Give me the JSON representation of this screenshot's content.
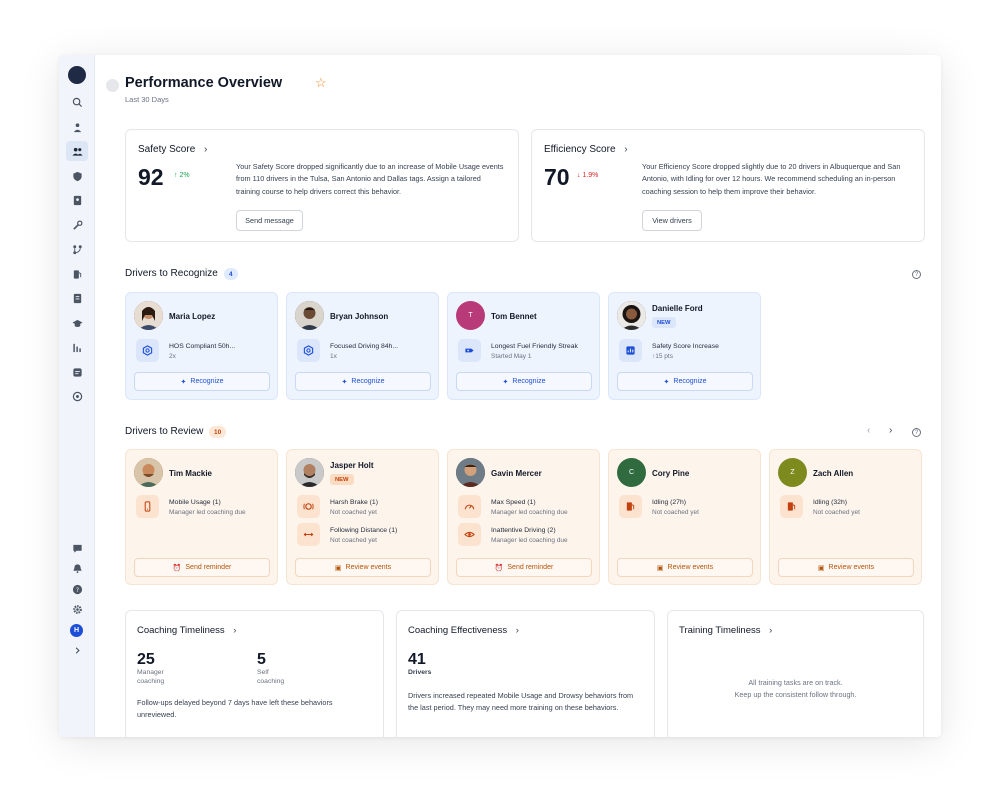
{
  "page": {
    "title": "Performance Overview",
    "subtitle": "Last 30 Days"
  },
  "sidebar": {
    "avatar_initial": "H",
    "icons": [
      "search-icon",
      "route-icon",
      "drivers-icon",
      "shield-icon",
      "id-card-icon",
      "wrench-icon",
      "routes-icon",
      "fuel-icon",
      "report-icon",
      "training-icon",
      "chart-icon",
      "messages-icon",
      "target-icon",
      "chat-icon",
      "bell-icon",
      "help-icon",
      "gear-icon",
      "expand-icon"
    ]
  },
  "scores": {
    "safety": {
      "title": "Safety Score",
      "value": "92",
      "delta": "2%",
      "description": "Your Safety Score dropped significantly due to an increase of Mobile Usage events from 110 drivers in the Tulsa, San Antonio and Dallas tags. Assign a tailored training course to help drivers correct this behavior.",
      "button": "Send message"
    },
    "efficiency": {
      "title": "Efficiency Score",
      "value": "70",
      "delta": "1.9%",
      "description": "Your Efficiency Score dropped slightly due to 20 drivers in Albuquerque and San Antonio, with Idling for over 12 hours. We recommend scheduling an in-person coaching session to help them improve their behavior.",
      "button": "View drivers"
    }
  },
  "recognize": {
    "title": "Drivers to Recognize",
    "count": "4",
    "drivers": [
      {
        "name": "Maria Lopez",
        "achievement": "HOS Compliant 50h...",
        "detail": "2x",
        "button": "Recognize",
        "badge": ""
      },
      {
        "name": "Bryan Johnson",
        "achievement": "Focused Driving 84h...",
        "detail": "1x",
        "button": "Recognize",
        "badge": ""
      },
      {
        "name": "Tom Bennet",
        "initial": "T",
        "achievement": "Longest Fuel Friendly Streak",
        "detail": "Started May 1",
        "button": "Recognize",
        "badge": ""
      },
      {
        "name": "Danielle Ford",
        "achievement": "Safety Score Increase",
        "detail": "↑15 pts",
        "button": "Recognize",
        "badge": "NEW"
      }
    ]
  },
  "review": {
    "title": "Drivers to Review",
    "count": "10",
    "drivers": [
      {
        "name": "Tim Mackie",
        "badge": "",
        "items": [
          {
            "title": "Mobile Usage (1)",
            "status": "Manager led coaching due"
          }
        ],
        "button": "Send reminder"
      },
      {
        "name": "Jasper Holt",
        "badge": "NEW",
        "items": [
          {
            "title": "Harsh Brake (1)",
            "status": "Not coached yet"
          },
          {
            "title": "Following Distance (1)",
            "status": "Not coached yet"
          }
        ],
        "button": "Review events"
      },
      {
        "name": "Gavin Mercer",
        "badge": "",
        "items": [
          {
            "title": "Max Speed (1)",
            "status": "Manager led coaching due"
          },
          {
            "title": "Inattentive Driving (2)",
            "status": "Manager led coaching due"
          }
        ],
        "button": "Send reminder"
      },
      {
        "name": "Cory Pine",
        "initial": "C",
        "badge": "",
        "items": [
          {
            "title": "Idling (27h)",
            "status": "Not coached yet"
          }
        ],
        "button": "Review events"
      },
      {
        "name": "Zach Allen",
        "initial": "Z",
        "badge": "",
        "items": [
          {
            "title": "Idling (32h)",
            "status": "Not coached yet"
          }
        ],
        "button": "Review events"
      }
    ]
  },
  "metrics": {
    "timeliness": {
      "title": "Coaching Timeliness",
      "manager_value": "25",
      "manager_label": "Manager coaching",
      "self_value": "5",
      "self_label": "Self coaching",
      "description": "Follow-ups delayed beyond 7 days have left these behaviors unreviewed."
    },
    "effectiveness": {
      "title": "Coaching Effectiveness",
      "value": "41",
      "label": "Drivers",
      "description": "Drivers increased repeated Mobile Usage and Drowsy behaviors from the last period. They may need more training on these behaviors."
    },
    "training": {
      "title": "Training Timeliness",
      "line1": "All training tasks are on track.",
      "line2": "Keep up the consistent follow through."
    }
  },
  "colors": {
    "accent_blue": "#1d4ed8",
    "accent_orange": "#c2410c",
    "up_green": "#16a34a",
    "down_red": "#dc2626"
  }
}
